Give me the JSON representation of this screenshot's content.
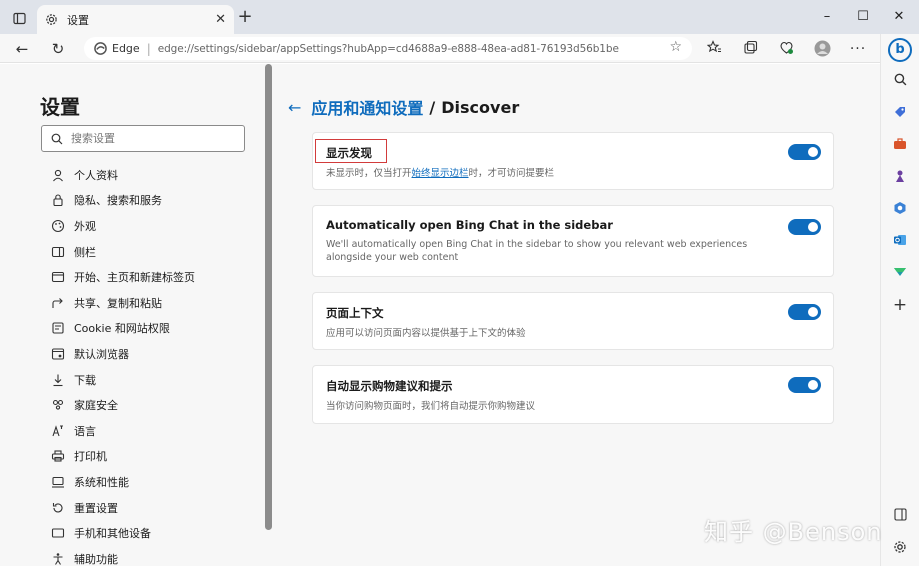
{
  "browser": {
    "tab_title": "设置",
    "tab_close": "✕",
    "new_tab": "+",
    "window_controls": {
      "minimize": "–",
      "maximize": "☐",
      "close": "✕"
    },
    "nav": {
      "back": "←",
      "refresh": "↻"
    },
    "address": {
      "site_name": "Edge",
      "url": "edge://settings/sidebar/appSettings?hubApp=cd4688a9-e888-48ea-ad81-76193d56b1be"
    }
  },
  "settings_nav": {
    "title": "设置",
    "search_placeholder": "搜索设置",
    "items": [
      {
        "label": "个人资料",
        "icon": "profile-icon"
      },
      {
        "label": "隐私、搜索和服务",
        "icon": "lock-icon"
      },
      {
        "label": "外观",
        "icon": "appearance-icon"
      },
      {
        "label": "侧栏",
        "icon": "sidebar-icon"
      },
      {
        "label": "开始、主页和新建标签页",
        "icon": "home-icon"
      },
      {
        "label": "共享、复制和粘贴",
        "icon": "share-icon"
      },
      {
        "label": "Cookie 和网站权限",
        "icon": "cookie-icon"
      },
      {
        "label": "默认浏览器",
        "icon": "browser-icon"
      },
      {
        "label": "下载",
        "icon": "download-icon"
      },
      {
        "label": "家庭安全",
        "icon": "family-icon"
      },
      {
        "label": "语言",
        "icon": "language-icon"
      },
      {
        "label": "打印机",
        "icon": "printer-icon"
      },
      {
        "label": "系统和性能",
        "icon": "system-icon"
      },
      {
        "label": "重置设置",
        "icon": "reset-icon"
      },
      {
        "label": "手机和其他设备",
        "icon": "phone-icon"
      },
      {
        "label": "辅助功能",
        "icon": "accessibility-icon"
      }
    ]
  },
  "page": {
    "back_arrow": "←",
    "title": "应用和通知设置",
    "separator": "/",
    "subtitle": "Discover",
    "cards": [
      {
        "title": "显示发现",
        "desc_before": "未显示时，仅当打开",
        "link": "始终显示边栏",
        "desc_after": "时，才可访问提要栏",
        "toggle_on": true
      },
      {
        "title": "Automatically open Bing Chat in the sidebar",
        "desc": "We'll automatically open Bing Chat in the sidebar to show you relevant web experiences alongside your web content",
        "toggle_on": true
      },
      {
        "title": "页面上下文",
        "desc": "应用可以访问页面内容以提供基于上下文的体验",
        "toggle_on": true
      },
      {
        "title": "自动显示购物建议和提示",
        "desc": "当你访问购物页面时，我们将自动提示你购物建议",
        "toggle_on": true
      }
    ]
  },
  "watermark": "知乎 @Benson",
  "colors": {
    "accent": "#0f6cbd",
    "highlight_box": "#d23b3b"
  }
}
